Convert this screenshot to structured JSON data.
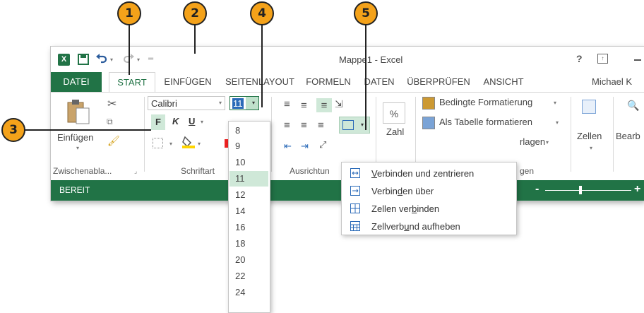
{
  "callouts": [
    "1",
    "2",
    "3",
    "4",
    "5"
  ],
  "title": {
    "app_title": "Mappe1 - Excel",
    "help": "?",
    "user": "Michael K"
  },
  "tabs": [
    "DATEI",
    "START",
    "EINFÜGEN",
    "SEITENLAYOUT",
    "FORMELN",
    "DATEN",
    "ÜBERPRÜFEN",
    "ANSICHT"
  ],
  "ribbon": {
    "clipboard": {
      "paste_label": "Einfügen",
      "group_label": "Zwischenabla..."
    },
    "font": {
      "font_name": "Calibri",
      "font_size": "11",
      "bold": "F",
      "italic": "K",
      "underline": "U",
      "group_label": "Schriftart"
    },
    "alignment": {
      "group_label": "Ausrichtun"
    },
    "number": {
      "percent": "%",
      "label": "Zahl"
    },
    "styles": {
      "conditional": "Bedingte Formatierung",
      "as_table": "Als Tabelle formatieren",
      "cell_styles_partial": "rlagen",
      "group_partial": "gen"
    },
    "cells": {
      "label": "Zellen"
    },
    "editing": {
      "label": "Bearb"
    }
  },
  "status": {
    "text": "BEREIT",
    "zoom_minus": "-",
    "zoom_plus": "+"
  },
  "size_list": [
    "8",
    "9",
    "10",
    "11",
    "12",
    "14",
    "16",
    "18",
    "20",
    "22",
    "24"
  ],
  "size_selected": "11",
  "merge_menu": [
    {
      "pre": "",
      "u": "V",
      "post": "erbinden und zentrieren"
    },
    {
      "pre": "Verbin",
      "u": "d",
      "post": "en über"
    },
    {
      "pre": "Zellen ver",
      "u": "b",
      "post": "inden"
    },
    {
      "pre": "Zellverb",
      "u": "u",
      "post": "nd aufheben"
    }
  ],
  "colors": {
    "excel_green": "#217346",
    "callout": "#f4a21a",
    "selected": "#cfe8d8"
  }
}
